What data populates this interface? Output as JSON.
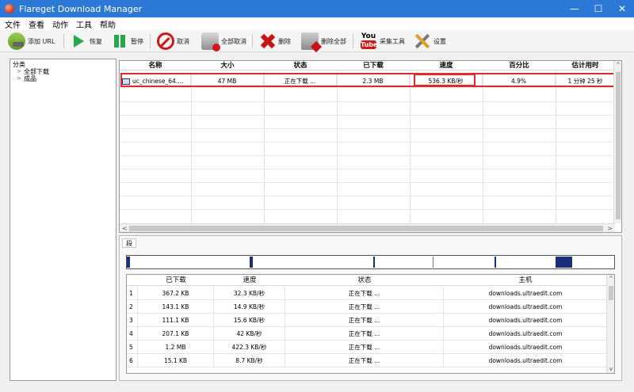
{
  "window": {
    "title": "Flareget Download Manager",
    "controls": {
      "minimize": "—",
      "maximize": "☐",
      "close": "✕"
    }
  },
  "menu": [
    "文件",
    "查看",
    "动作",
    "工具",
    "帮助"
  ],
  "toolbar": {
    "add_url": "添加 URL",
    "resume": "恢复",
    "pause": "暂停",
    "cancel": "取消",
    "cancel_all": "全部取消",
    "delete": "删除",
    "delete_all": "删除全部",
    "grabber": "采集工具",
    "settings": "设置",
    "yt_you": "You",
    "yt_tube": "Tube"
  },
  "tree": {
    "root": "分类",
    "items": [
      "全部下载",
      "成品"
    ]
  },
  "downloads": {
    "columns": [
      "名称",
      "大小",
      "状态",
      "已下载",
      "速度",
      "百分比",
      "估计用时"
    ],
    "rows": [
      {
        "name": "uc_chinese_64.…",
        "size": "47 MB",
        "status": "正在下载 ...",
        "downloaded": "2.3 MB",
        "speed": "536.3 KB/秒",
        "percent": "4.9%",
        "eta": "1 分钟 25 秒"
      }
    ]
  },
  "details": {
    "tab": "段",
    "segments": [
      {
        "start": 0.0,
        "end": 0.006
      },
      {
        "start": 0.252,
        "end": 0.258
      },
      {
        "start": 0.505,
        "end": 0.509
      },
      {
        "start": 0.755,
        "end": 0.759
      },
      {
        "start": 0.88,
        "end": 0.914
      }
    ],
    "columns": [
      "已下载",
      "速度",
      "状态",
      "主机"
    ],
    "connections": [
      {
        "idx": "1",
        "downloaded": "367.2 KB",
        "speed": "32.3 KB/秒",
        "status": "正在下载 ...",
        "host": "downloads.ultraedit.com"
      },
      {
        "idx": "2",
        "downloaded": "143.1 KB",
        "speed": "14.9 KB/秒",
        "status": "正在下载 ...",
        "host": "downloads.ultraedit.com"
      },
      {
        "idx": "3",
        "downloaded": "111.1 KB",
        "speed": "15.6 KB/秒",
        "status": "正在下载 ...",
        "host": "downloads.ultraedit.com"
      },
      {
        "idx": "4",
        "downloaded": "207.1 KB",
        "speed": "42 KB/秒",
        "status": "正在下载 ...",
        "host": "downloads.ultraedit.com"
      },
      {
        "idx": "5",
        "downloaded": "1.2 MB",
        "speed": "422.3 KB/秒",
        "status": "正在下载 ...",
        "host": "downloads.ultraedit.com"
      },
      {
        "idx": "6",
        "downloaded": "15.1 KB",
        "speed": "8.7 KB/秒",
        "status": "正在下载 ...",
        "host": "downloads.ultraedit.com"
      }
    ]
  },
  "scroll_glyphs": {
    "up": "^",
    "down": "v",
    "left": "<",
    "right": ">"
  }
}
